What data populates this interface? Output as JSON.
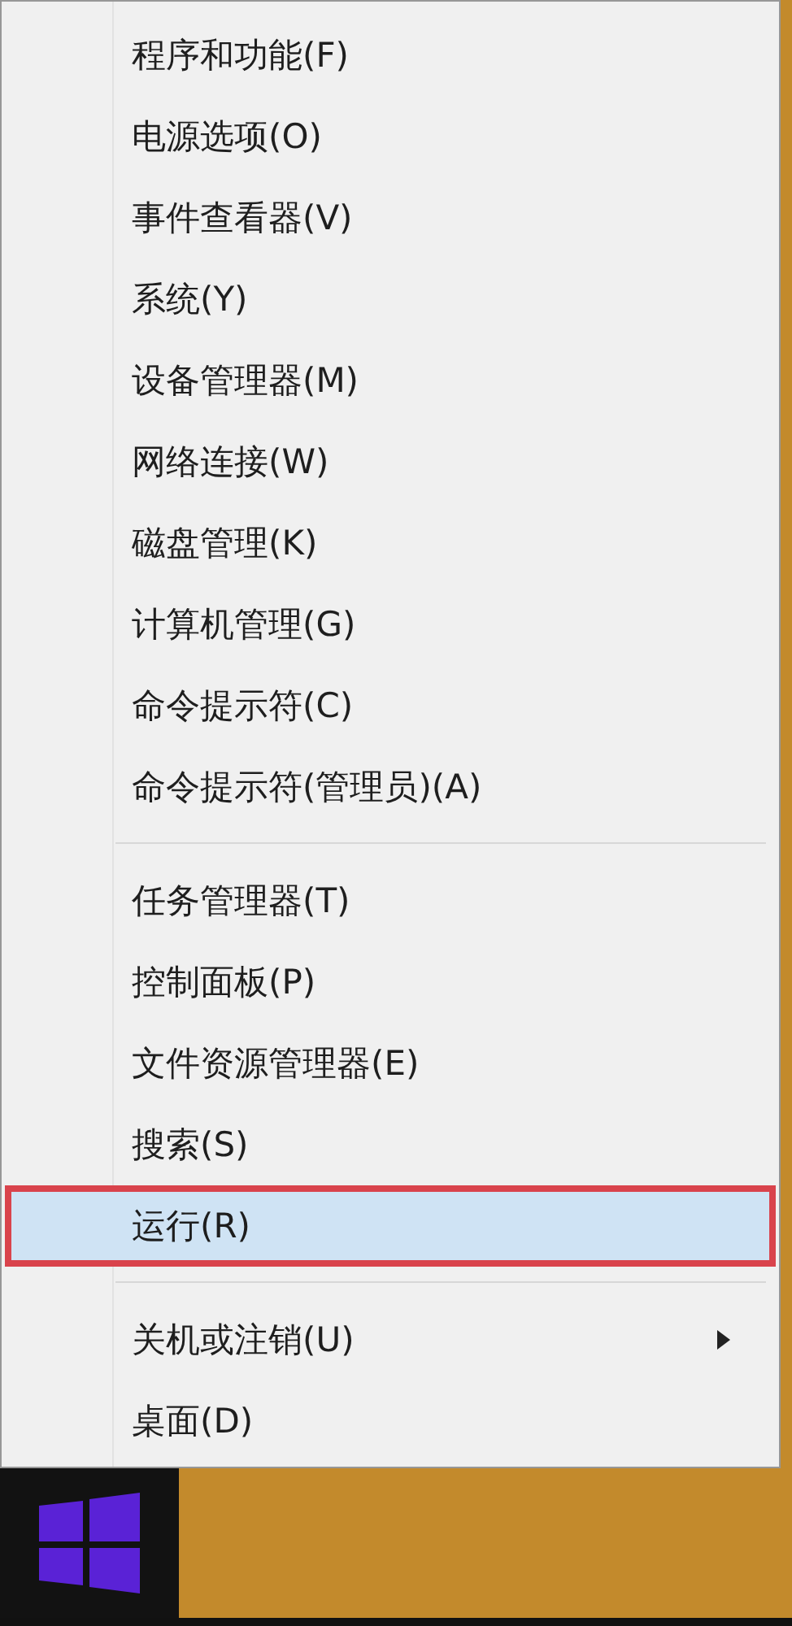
{
  "context_menu": {
    "groups": [
      {
        "items": [
          {
            "label": "程序和功能(F)",
            "selected": false,
            "has_submenu": false,
            "annotated": false
          },
          {
            "label": "电源选项(O)",
            "selected": false,
            "has_submenu": false,
            "annotated": false
          },
          {
            "label": "事件查看器(V)",
            "selected": false,
            "has_submenu": false,
            "annotated": false
          },
          {
            "label": "系统(Y)",
            "selected": false,
            "has_submenu": false,
            "annotated": false
          },
          {
            "label": "设备管理器(M)",
            "selected": false,
            "has_submenu": false,
            "annotated": false
          },
          {
            "label": "网络连接(W)",
            "selected": false,
            "has_submenu": false,
            "annotated": false
          },
          {
            "label": "磁盘管理(K)",
            "selected": false,
            "has_submenu": false,
            "annotated": false
          },
          {
            "label": "计算机管理(G)",
            "selected": false,
            "has_submenu": false,
            "annotated": false
          },
          {
            "label": "命令提示符(C)",
            "selected": false,
            "has_submenu": false,
            "annotated": false
          },
          {
            "label": "命令提示符(管理员)(A)",
            "selected": false,
            "has_submenu": false,
            "annotated": false
          }
        ]
      },
      {
        "items": [
          {
            "label": "任务管理器(T)",
            "selected": false,
            "has_submenu": false,
            "annotated": false
          },
          {
            "label": "控制面板(P)",
            "selected": false,
            "has_submenu": false,
            "annotated": false
          },
          {
            "label": "文件资源管理器(E)",
            "selected": false,
            "has_submenu": false,
            "annotated": false
          },
          {
            "label": "搜索(S)",
            "selected": false,
            "has_submenu": false,
            "annotated": false
          },
          {
            "label": "运行(R)",
            "selected": true,
            "has_submenu": false,
            "annotated": true
          }
        ]
      },
      {
        "items": [
          {
            "label": "关机或注销(U)",
            "selected": false,
            "has_submenu": true,
            "annotated": false
          },
          {
            "label": "桌面(D)",
            "selected": false,
            "has_submenu": false,
            "annotated": false
          }
        ]
      }
    ]
  }
}
